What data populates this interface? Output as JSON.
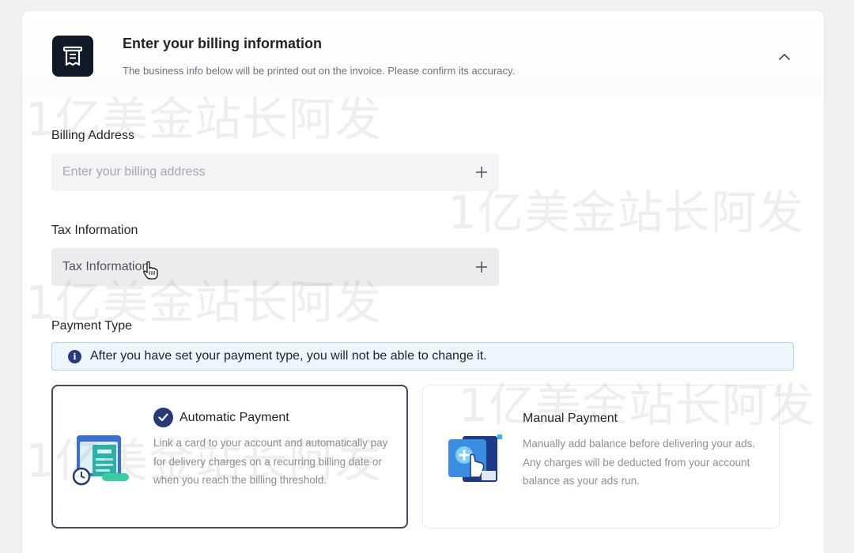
{
  "header": {
    "title": "Enter your billing information",
    "subtitle": "The business info below will be printed out on the invoice. Please confirm its accuracy."
  },
  "billing_address": {
    "label": "Billing Address",
    "placeholder": "Enter your billing address"
  },
  "tax_information": {
    "label": "Tax Information",
    "placeholder": "Tax Information"
  },
  "payment_type": {
    "label": "Payment Type",
    "notice": "After you have set your payment type, you will not be able to change it.",
    "options": [
      {
        "title": "Automatic Payment",
        "description": "Link a card to your account and automatically pay for delivery charges on a recurring billing date or when you reach the billing threshold.",
        "selected": true
      },
      {
        "title": "Manual Payment",
        "description": "Manually add balance before delivering your ads. Any charges will be deducted from your account balance as your ads run.",
        "selected": false
      }
    ]
  },
  "watermark": "1亿美金站长阿发",
  "colors": {
    "accent": "#263a78",
    "logo_bg": "#111827",
    "notice_bg": "#eef5fb",
    "notice_border": "#b9d3e6"
  },
  "icons": {
    "logo": "receipt-icon",
    "collapse": "chevron-up-icon",
    "add": "plus-icon",
    "notice": "info-icon",
    "selected": "check-circle-icon"
  }
}
